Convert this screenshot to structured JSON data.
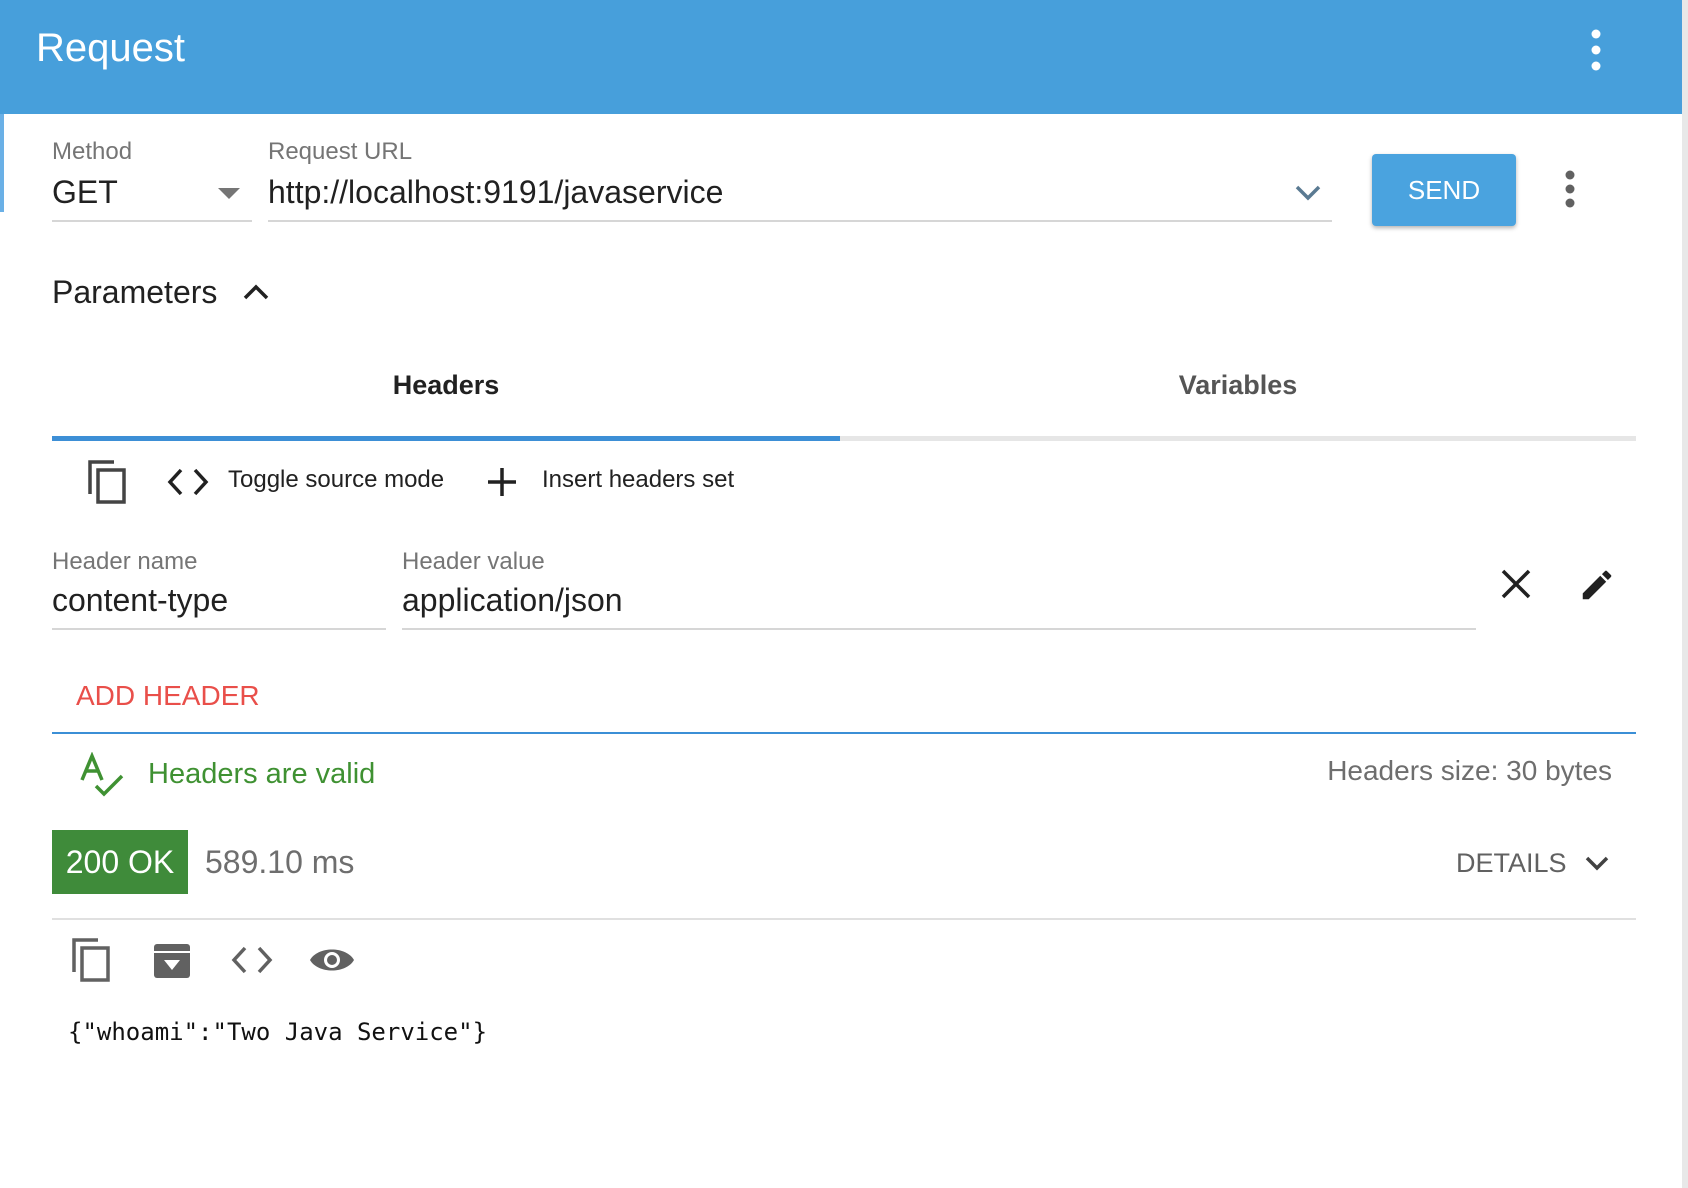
{
  "appbar": {
    "title": "Request",
    "menu_icon": "more-vert-icon"
  },
  "request": {
    "method_label": "Method",
    "method_value": "GET",
    "url_label": "Request URL",
    "url_value": "http://localhost:9191/javaservice",
    "send_label": "SEND"
  },
  "parameters": {
    "title": "Parameters",
    "tabs": [
      {
        "label": "Headers",
        "active": true
      },
      {
        "label": "Variables",
        "active": false
      }
    ],
    "toolbar": {
      "copy_icon": "copy-icon",
      "toggle_label": "Toggle source mode",
      "insert_label": "Insert headers set"
    },
    "header_row": {
      "name_label": "Header name",
      "name_value": "content-type",
      "value_label": "Header value",
      "value_value": "application/json"
    },
    "add_header_label": "ADD HEADER",
    "valid_text": "Headers are valid",
    "size_text": "Headers size: 30 bytes"
  },
  "response": {
    "status": "200 OK",
    "time": "589.10 ms",
    "details_label": "DETAILS",
    "body": "{\"whoami\":\"Two Java Service\"}"
  },
  "colors": {
    "appbar": "#479fdb",
    "accent": "#3d8fd6",
    "send_button": "#4aa3df",
    "add_header": "#e94f4a",
    "valid": "#3f9132",
    "status_ok": "#3f8b3a"
  }
}
